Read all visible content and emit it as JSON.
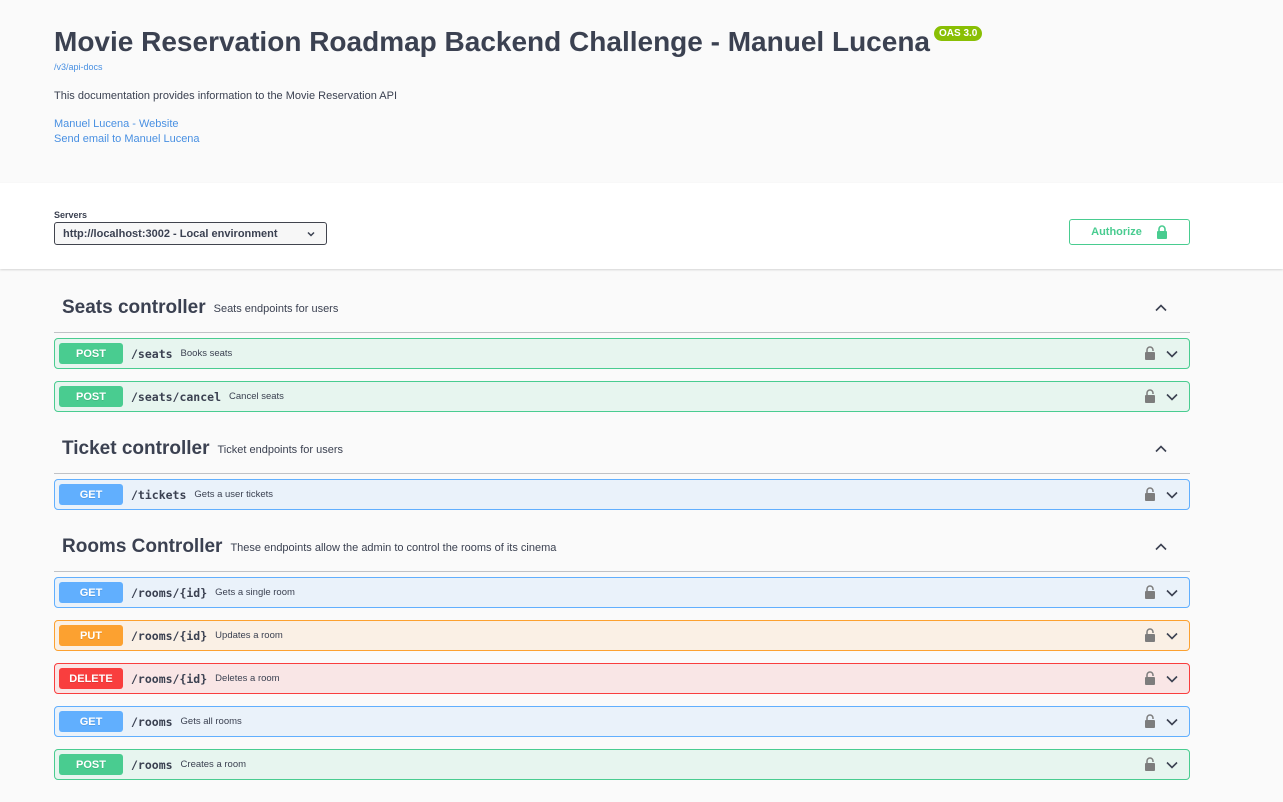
{
  "info": {
    "title": "Movie Reservation Roadmap Backend Challenge - Manuel Lucena",
    "badge": "OAS 3.0",
    "api_url": "/v3/api-docs",
    "description": "This documentation provides information to the Movie Reservation API",
    "links": [
      "Manuel Lucena - Website",
      "Send email to Manuel Lucena"
    ]
  },
  "servers": {
    "label": "Servers",
    "selected": "http://localhost:3002 - Local environment"
  },
  "authorize": {
    "label": "Authorize"
  },
  "tags": [
    {
      "name": "Seats controller",
      "description": "Seats endpoints for users",
      "operations": [
        {
          "method": "POST",
          "path": "/seats",
          "summary": "Books seats"
        },
        {
          "method": "POST",
          "path": "/seats/cancel",
          "summary": "Cancel seats"
        }
      ]
    },
    {
      "name": "Ticket controller",
      "description": "Ticket endpoints for users",
      "operations": [
        {
          "method": "GET",
          "path": "/tickets",
          "summary": "Gets a user tickets"
        }
      ]
    },
    {
      "name": "Rooms Controller",
      "description": "These endpoints allow the admin to control the rooms of its cinema",
      "operations": [
        {
          "method": "GET",
          "path": "/rooms/{id}",
          "summary": "Gets a single room"
        },
        {
          "method": "PUT",
          "path": "/rooms/{id}",
          "summary": "Updates a room"
        },
        {
          "method": "DELETE",
          "path": "/rooms/{id}",
          "summary": "Deletes a room"
        },
        {
          "method": "GET",
          "path": "/rooms",
          "summary": "Gets all rooms"
        },
        {
          "method": "POST",
          "path": "/rooms",
          "summary": "Creates a room"
        }
      ]
    }
  ],
  "colors": {
    "post": "#49cc90",
    "get": "#61affe",
    "put": "#fca130",
    "delete": "#f93e3e",
    "badge": "#89bf04",
    "link": "#4990e2"
  }
}
